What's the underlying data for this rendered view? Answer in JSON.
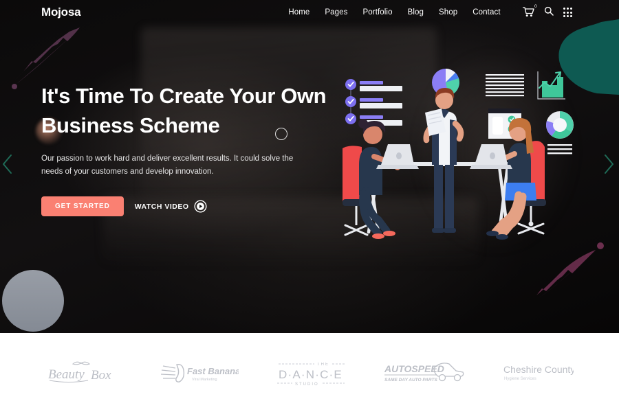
{
  "header": {
    "logo": "Mojosa",
    "nav": [
      {
        "label": "Home"
      },
      {
        "label": "Pages"
      },
      {
        "label": "Portfolio"
      },
      {
        "label": "Blog"
      },
      {
        "label": "Shop"
      },
      {
        "label": "Contact"
      }
    ],
    "cart_icon": "cart-icon",
    "cart_count": "0",
    "search_icon": "search-icon",
    "grid_menu_icon": "grid-menu-icon"
  },
  "hero": {
    "headline": "It's Time To Create Your Own Business Scheme",
    "subtext": "Our passion to work hard and deliver excellent results. It could solve the needs of your customers and develop innovation.",
    "cta_primary": "GET STARTED",
    "cta_secondary": "WATCH VIDEO",
    "play_icon": "play-circle-icon",
    "prev_arrow_icon": "chevron-left-icon",
    "next_arrow_icon": "chevron-right-icon"
  },
  "colors": {
    "accent": "#fa8072",
    "teal": "#0e5a52",
    "purple": "#7c6ff0",
    "mint": "#4fd1ab",
    "arrow": "#1f5c4f",
    "grey_circle": "#8b9099",
    "background": "#050505",
    "footer_bg": "#ffffff"
  },
  "decor": [
    {
      "name": "comet-top-left",
      "icon": "comet-shape"
    },
    {
      "name": "comet-bottom-right",
      "icon": "comet-shape"
    },
    {
      "name": "teal-blob",
      "icon": "blob-shape"
    },
    {
      "name": "grey-circle",
      "icon": "circle-shape"
    },
    {
      "name": "outline-ring",
      "icon": "ring-shape"
    },
    {
      "name": "x-mark",
      "icon": "x-shape"
    }
  ],
  "illustration": {
    "name": "business-team-illustration",
    "checklist_items": 3,
    "pie_chart": "pie-chart-graphic",
    "donut_chart": "donut-chart-graphic",
    "bar_chart": "bar-chart-graphic",
    "document": "checklist-document-graphic",
    "people": [
      "woman-seated-left",
      "man-standing-center",
      "woman-seated-right"
    ]
  },
  "brands": [
    {
      "name": "BeautyBox",
      "tagline": ""
    },
    {
      "name": "Fast Banana",
      "tagline": "Viral Marketing"
    },
    {
      "name": "D·A·N·C·E",
      "tagline": "STUDIO",
      "eyebrow": "THE"
    },
    {
      "name": "AUTOSPEED",
      "tagline": "SAME DAY AUTO PARTS"
    },
    {
      "name": "Cheshire County",
      "tagline": "Hygiene Services"
    }
  ]
}
